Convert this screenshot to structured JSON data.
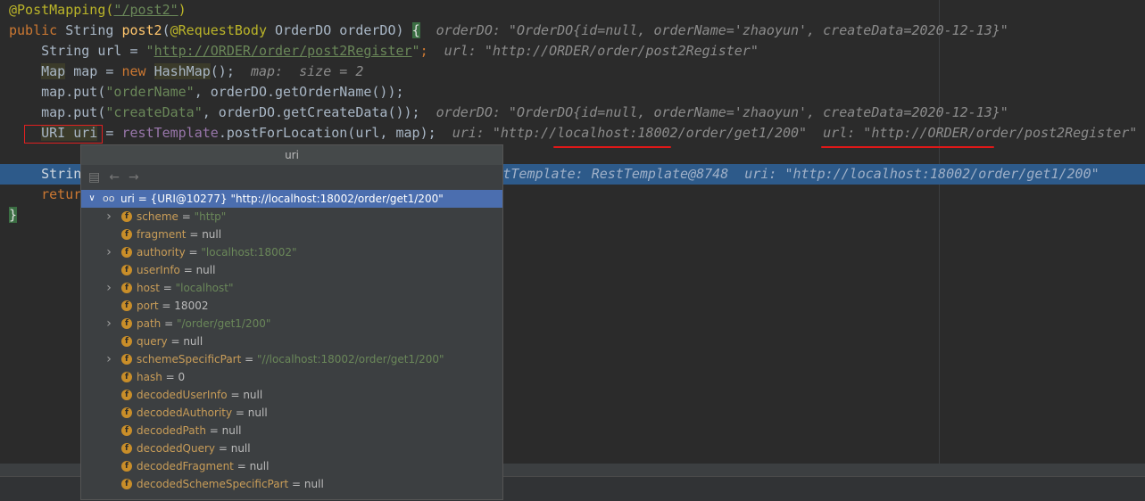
{
  "code": {
    "l1_ann": "@PostMapping(",
    "l1_str": "\"/post2\"",
    "l1_end": ")",
    "l2_kw": "public",
    "l2_type": " String ",
    "l2_fn": "post2",
    "l2_paren": "(",
    "l2_ann": "@RequestBody",
    "l2_rest": " OrderDO orderDO) ",
    "l2_brace": "{",
    "l2_hint": "orderDO: \"OrderDO{id=null, orderName='zhaoyun', createData=2020-12-13}\"",
    "l3_a": "String url = ",
    "l3_q1": "\"",
    "l3_link": "http://ORDER/order/post2Register",
    "l3_q2": "\"",
    "l3_semi": ";",
    "l3_hint": "url: \"http://ORDER/order/post2Register\"",
    "l4_type": "Map",
    "l4_a": " map = ",
    "l4_new": "new",
    "l4_cls": "HashMap",
    "l4_b": "();",
    "l4_hint": "map:  size = 2",
    "l5_a": "map.put(",
    "l5_str": "\"orderName\"",
    "l5_b": ", orderDO.getOrderName());",
    "l6_a": "map.put(",
    "l6_str": "\"createData\"",
    "l6_b": ", orderDO.getCreateData());",
    "l6_hint": "orderDO: \"OrderDO{id=null, orderName='zhaoyun', createData=2020-12-13}\"",
    "l7_a": "URI uri",
    "l7_b": " = ",
    "l7_field": "restTemplate",
    "l7_c": ".postForLocation(url, map);",
    "l7_hint1": "uri: \"http://localhost:18002/order/get1/200\"",
    "l7_hint2": "url: \"http://ORDER/order/post2Register\"",
    "l8_a": "Strin",
    "l8_hint": "restTemplate: RestTemplate@8748  uri: \"http://localhost:18002/order/get1/200\"",
    "l9_a": "retur",
    "l10_a": "}"
  },
  "popup": {
    "title": "uri",
    "root": "uri = {URI@10277} \"http://localhost:18002/order/get1/200\"",
    "fields": [
      {
        "name": "scheme",
        "value": "\"http\"",
        "kind": "str",
        "expandable": true
      },
      {
        "name": "fragment",
        "value": "null",
        "kind": "plain",
        "expandable": false
      },
      {
        "name": "authority",
        "value": "\"localhost:18002\"",
        "kind": "str",
        "expandable": true
      },
      {
        "name": "userInfo",
        "value": "null",
        "kind": "plain",
        "expandable": false
      },
      {
        "name": "host",
        "value": "\"localhost\"",
        "kind": "str",
        "expandable": true
      },
      {
        "name": "port",
        "value": "18002",
        "kind": "plain",
        "expandable": false
      },
      {
        "name": "path",
        "value": "\"/order/get1/200\"",
        "kind": "str",
        "expandable": true
      },
      {
        "name": "query",
        "value": "null",
        "kind": "plain",
        "expandable": false
      },
      {
        "name": "schemeSpecificPart",
        "value": "\"//localhost:18002/order/get1/200\"",
        "kind": "str",
        "expandable": true
      },
      {
        "name": "hash",
        "value": "0",
        "kind": "plain",
        "expandable": false
      },
      {
        "name": "decodedUserInfo",
        "value": "null",
        "kind": "plain",
        "expandable": false
      },
      {
        "name": "decodedAuthority",
        "value": "null",
        "kind": "plain",
        "expandable": false
      },
      {
        "name": "decodedPath",
        "value": "null",
        "kind": "plain",
        "expandable": false
      },
      {
        "name": "decodedQuery",
        "value": "null",
        "kind": "plain",
        "expandable": false
      },
      {
        "name": "decodedFragment",
        "value": "null",
        "kind": "plain",
        "expandable": false
      },
      {
        "name": "decodedSchemeSpecificPart",
        "value": "null",
        "kind": "plain",
        "expandable": false
      }
    ]
  }
}
